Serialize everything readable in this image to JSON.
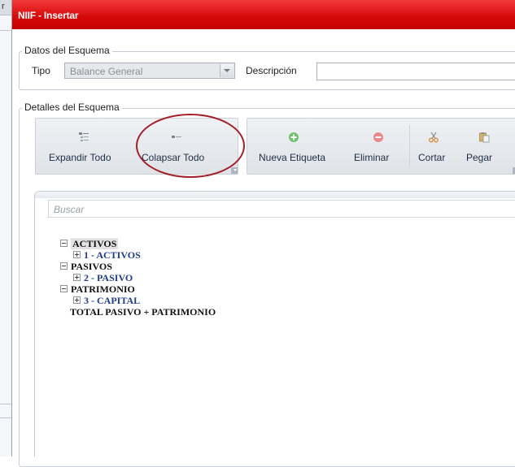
{
  "background_app": {
    "visible_char": "r"
  },
  "window": {
    "title": "NIIF - Insertar",
    "title_color": "#d90c0c"
  },
  "datos": {
    "legend": "Datos del Esquema",
    "tipo_label": "Tipo",
    "tipo_value": "Balance General",
    "descripcion_label": "Descripción",
    "descripcion_value": ""
  },
  "detalles": {
    "legend": "Detalles del Esquema"
  },
  "toolbar1": {
    "items": [
      {
        "label": "Expandir Todo",
        "icon": "expand-all-icon"
      },
      {
        "label": "Colapsar Todo",
        "icon": "collapse-all-icon"
      }
    ]
  },
  "toolbar2": {
    "items": [
      {
        "label": "Nueva Etiqueta",
        "icon": "add-icon"
      },
      {
        "label": "Eliminar",
        "icon": "delete-icon"
      },
      {
        "label": "Cortar",
        "icon": "cut-icon"
      },
      {
        "label": "Pegar",
        "icon": "paste-icon"
      }
    ]
  },
  "highlight_color": "#a31f27",
  "search": {
    "placeholder": "Buscar"
  },
  "tree": {
    "nodes": [
      {
        "label": "ACTIVOS",
        "expanded": true,
        "selected": true,
        "children": [
          {
            "label": "1 - ACTIVOS",
            "expanded": false
          }
        ]
      },
      {
        "label": "PASIVOS",
        "expanded": true,
        "children": [
          {
            "label": "2 - PASIVO",
            "expanded": false
          }
        ]
      },
      {
        "label": "PATRIMONIO",
        "expanded": true,
        "children": [
          {
            "label": "3 - CAPITAL",
            "expanded": false
          }
        ]
      }
    ],
    "total_label": "TOTAL PASIVO + PATRIMONIO"
  }
}
